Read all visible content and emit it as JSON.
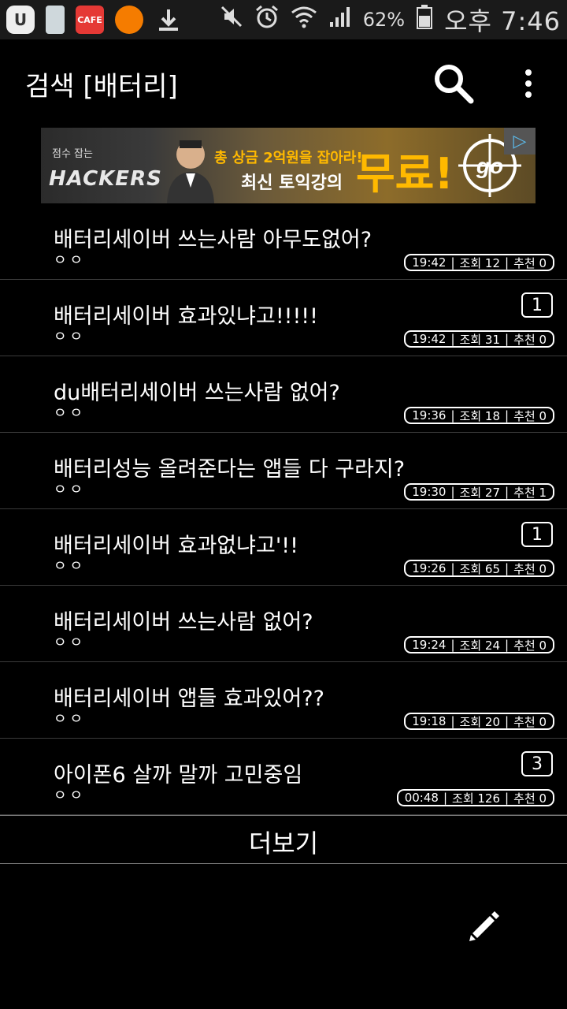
{
  "status": {
    "battery": "62%",
    "time": "오후 7:46",
    "cafe_label": "CAFE"
  },
  "appbar": {
    "title": "검색 [배터리]"
  },
  "ad": {
    "logo_small": "점수 잡는",
    "logo": "HACKERS",
    "line1": "총 상금 2억원을 잡아라!",
    "line2": "최신 토익강의",
    "big": "무료!",
    "go": "go"
  },
  "posts": [
    {
      "title": "배터리세이버 쓰는사람 아무도없어?",
      "sub": "ㅇㅇ",
      "time": "19:42",
      "views": "조회 12",
      "recommend": "추천 0",
      "comments": ""
    },
    {
      "title": "배터리세이버 효과있냐고!!!!!",
      "sub": "ㅇㅇ",
      "time": "19:42",
      "views": "조회 31",
      "recommend": "추천 0",
      "comments": "1"
    },
    {
      "title": "du배터리세이버 쓰는사람 없어?",
      "sub": "ㅇㅇ",
      "time": "19:36",
      "views": "조회 18",
      "recommend": "추천 0",
      "comments": ""
    },
    {
      "title": "배터리성능 올려준다는 앱들 다 구라지?",
      "sub": "ㅇㅇ",
      "time": "19:30",
      "views": "조회 27",
      "recommend": "추천 1",
      "comments": ""
    },
    {
      "title": "배터리세이버 효과없냐고'!!",
      "sub": "ㅇㅇ",
      "time": "19:26",
      "views": "조회 65",
      "recommend": "추천 0",
      "comments": "1"
    },
    {
      "title": "배터리세이버 쓰는사람 없어?",
      "sub": "ㅇㅇ",
      "time": "19:24",
      "views": "조회 24",
      "recommend": "추천 0",
      "comments": ""
    },
    {
      "title": "배터리세이버 앱들 효과있어??",
      "sub": "ㅇㅇ",
      "time": "19:18",
      "views": "조회 20",
      "recommend": "추천 0",
      "comments": ""
    },
    {
      "title": "아이폰6 살까 말까 고민중임",
      "sub": "ㅇㅇ",
      "time": "00:48",
      "views": "조회 126",
      "recommend": "추천 0",
      "comments": "3"
    }
  ],
  "more_label": "더보기",
  "icons": {
    "search": "search-icon",
    "menu": "overflow-menu-icon",
    "compose": "pencil-icon"
  }
}
